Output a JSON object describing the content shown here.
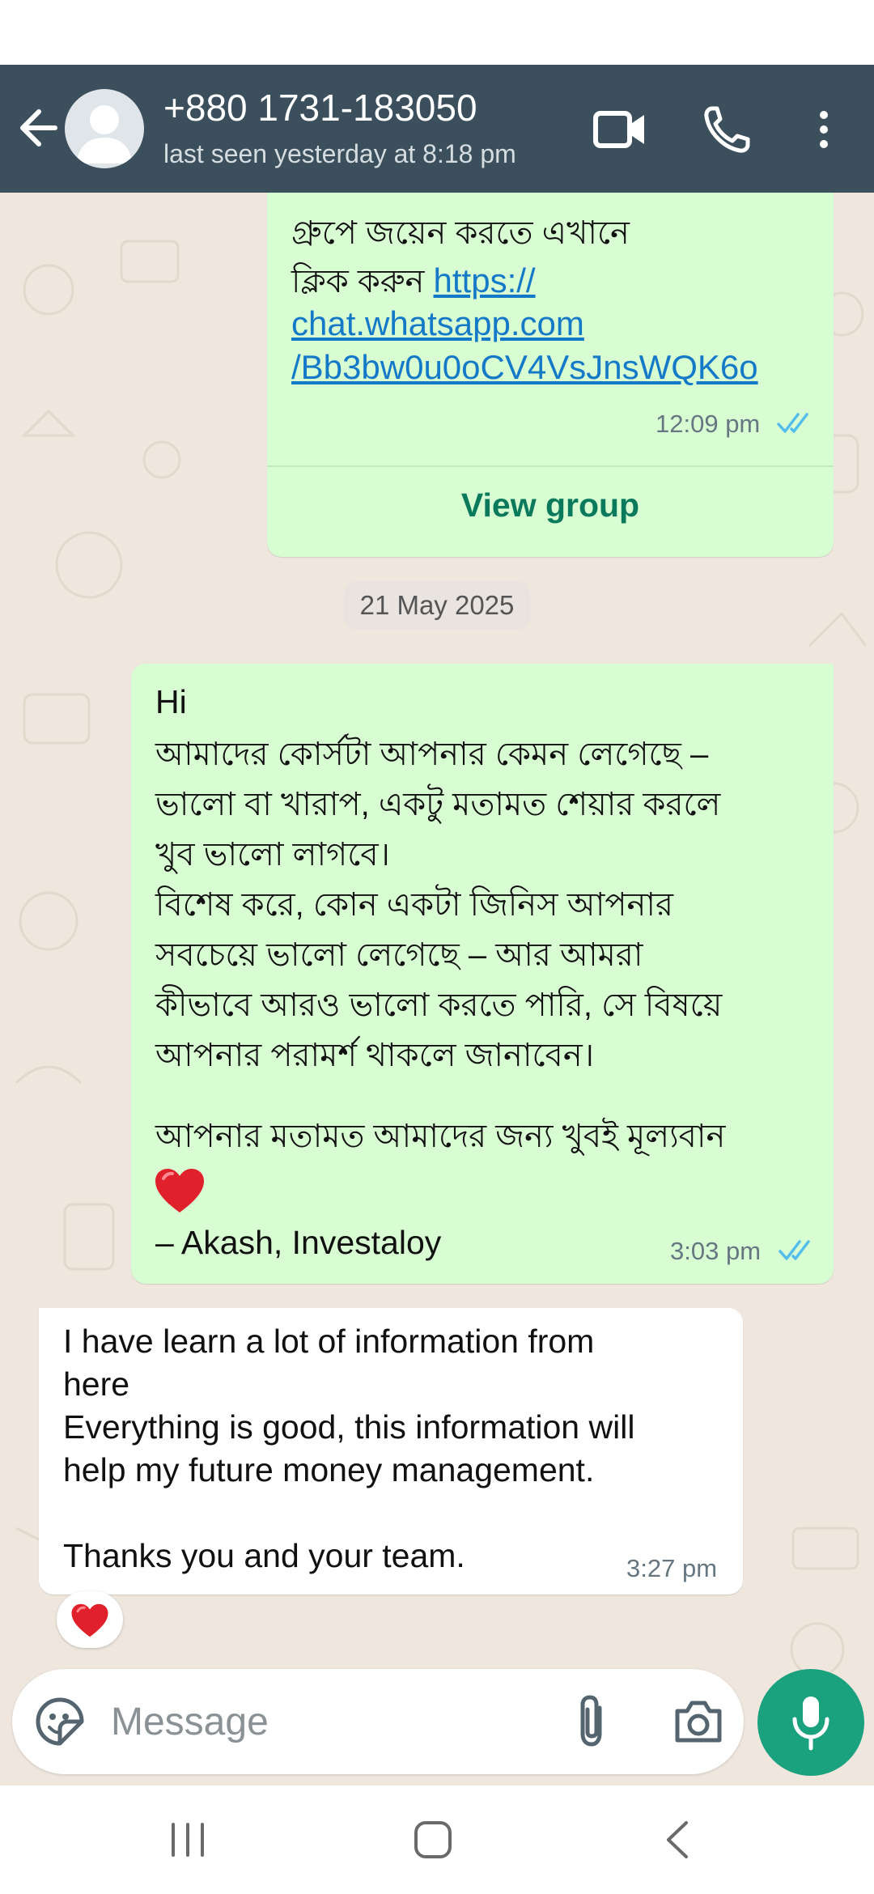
{
  "header": {
    "contact_name": "+880 1731-183050",
    "last_seen": "last seen yesterday at 8:18 pm"
  },
  "messages": {
    "group_invite": {
      "line1": "গ্রুপে জয়েন করতে এখানে",
      "line2_text": "ক্লিক করুন ",
      "link_part1": "https://",
      "link_part2": "chat.whatsapp.com",
      "link_part3": "/Bb3bw0u0oCV4VsJnsWQK6o",
      "time": "12:09 pm",
      "button": "View group"
    },
    "date_chip": "21 May 2025",
    "outgoing": {
      "lines": [
        "Hi",
        "আমাদের কোর্সটা আপনার কেমন লেগেছে –",
        "ভালো বা খারাপ, একটু মতামত শেয়ার করলে",
        "খুব ভালো লাগবে।",
        "বিশেষ করে, কোন একটা জিনিস আপনার",
        "সবচেয়ে ভালো লেগেছে – আর আমরা",
        "কীভাবে আরও ভালো করতে পারি, সে বিষয়ে",
        "আপনার পরামর্শ থাকলে জানাবেন।",
        "আপনার মতামত আমাদের জন্য খুবই মূল্যবান",
        "– Akash, Investaloy"
      ],
      "time": "3:03 pm"
    },
    "incoming": {
      "lines": [
        "I have learn a lot of information from",
        "here",
        "Everything is good, this information will",
        "help  my future money management.",
        "Thanks you and your team."
      ],
      "time": "3:27 pm"
    }
  },
  "input": {
    "placeholder": "Message"
  },
  "icons": {
    "back": "arrow-left-icon",
    "video": "video-camera-icon",
    "call": "phone-icon",
    "menu": "more-vertical-icon",
    "emoji": "sticker-icon",
    "attach": "paperclip-icon",
    "camera": "camera-icon",
    "mic": "microphone-icon"
  },
  "colors": {
    "header": "#3b4f5c",
    "outgoing_bubble": "#d9fdd3",
    "incoming_bubble": "#ffffff",
    "chat_background": "#efe7de",
    "read_ticks": "#53bdeb",
    "accent": "#1aa17e",
    "link": "#1479c7"
  }
}
